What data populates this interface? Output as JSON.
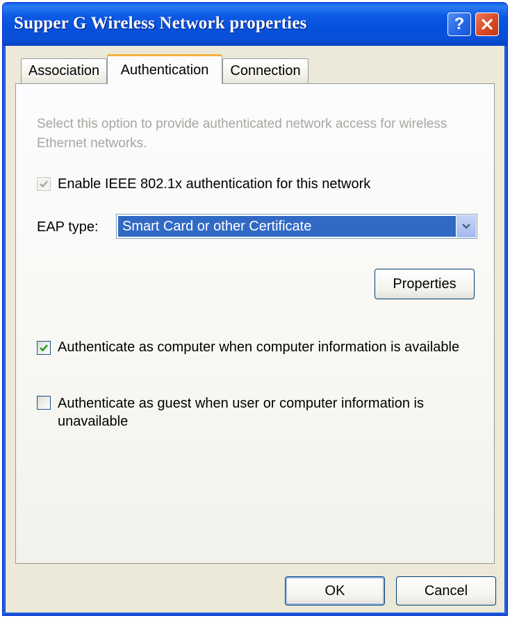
{
  "window": {
    "title": "Supper G Wireless Network properties",
    "help_glyph": "?",
    "accent_color": "#0550dc"
  },
  "tabs": [
    {
      "label": "Association",
      "active": false
    },
    {
      "label": "Authentication",
      "active": true
    },
    {
      "label": "Connection",
      "active": false
    }
  ],
  "authentication": {
    "description": "Select this option to provide authenticated network access for wireless Ethernet networks.",
    "enable_ieee": {
      "label": "Enable IEEE 802.1x authentication for this network",
      "checked": true,
      "enabled": false
    },
    "eap_label": "EAP type:",
    "eap_value": "Smart Card or other Certificate",
    "properties_label": "Properties",
    "auth_computer": {
      "label": "Authenticate as computer when computer information is available",
      "checked": true
    },
    "auth_guest": {
      "label": "Authenticate as guest when user or computer information is unavailable",
      "checked": false
    }
  },
  "footer": {
    "ok_label": "OK",
    "cancel_label": "Cancel"
  },
  "icons": {
    "help": "help-icon",
    "close": "close-icon",
    "check": "checkmark-icon",
    "dropdown": "chevron-down-icon"
  }
}
